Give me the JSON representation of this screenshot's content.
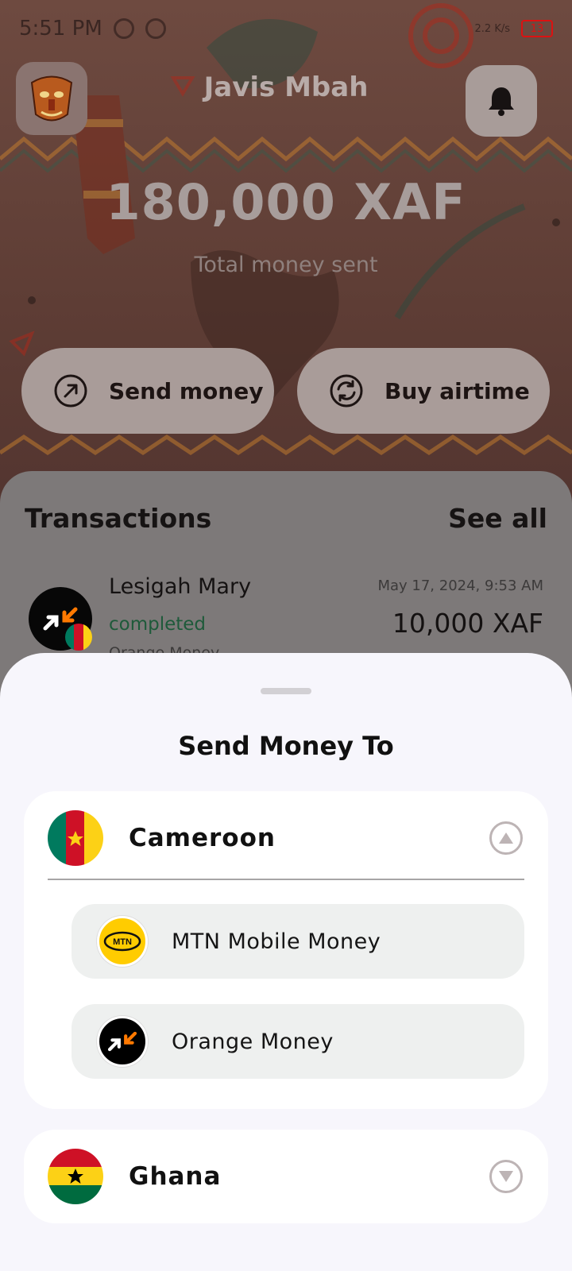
{
  "status_bar": {
    "time": "5:51 PM",
    "speed": "2.2 K/s",
    "battery": "13"
  },
  "header": {
    "user_name": "Javis Mbah",
    "avatar_icon": "tribal-mask-avatar",
    "notification_icon": "bell-icon",
    "total_amount": "180,000 XAF",
    "total_label": "Total money sent"
  },
  "actions": {
    "send_label": "Send money",
    "airtime_label": "Buy airtime"
  },
  "transactions": {
    "title": "Transactions",
    "see_all": "See all",
    "items": [
      {
        "name": "Lesigah Mary",
        "status": "completed",
        "provider": "Orange Money",
        "date": "May 17, 2024, 9:53 AM",
        "amount": "10,000 XAF"
      }
    ]
  },
  "sheet": {
    "title": "Send Money To",
    "countries": [
      {
        "name": "Cameroon",
        "expanded": true,
        "providers": [
          {
            "name": "MTN Mobile Money",
            "logo_text": "MTN",
            "color": "#ffcc00"
          },
          {
            "name": "Orange Money",
            "color": "#000000"
          }
        ]
      },
      {
        "name": "Ghana",
        "expanded": false
      }
    ]
  },
  "colors": {
    "status_completed": "#1e5a3a",
    "sheet_bg": "#f7f6fc",
    "provider_bg": "#eef0ef"
  }
}
